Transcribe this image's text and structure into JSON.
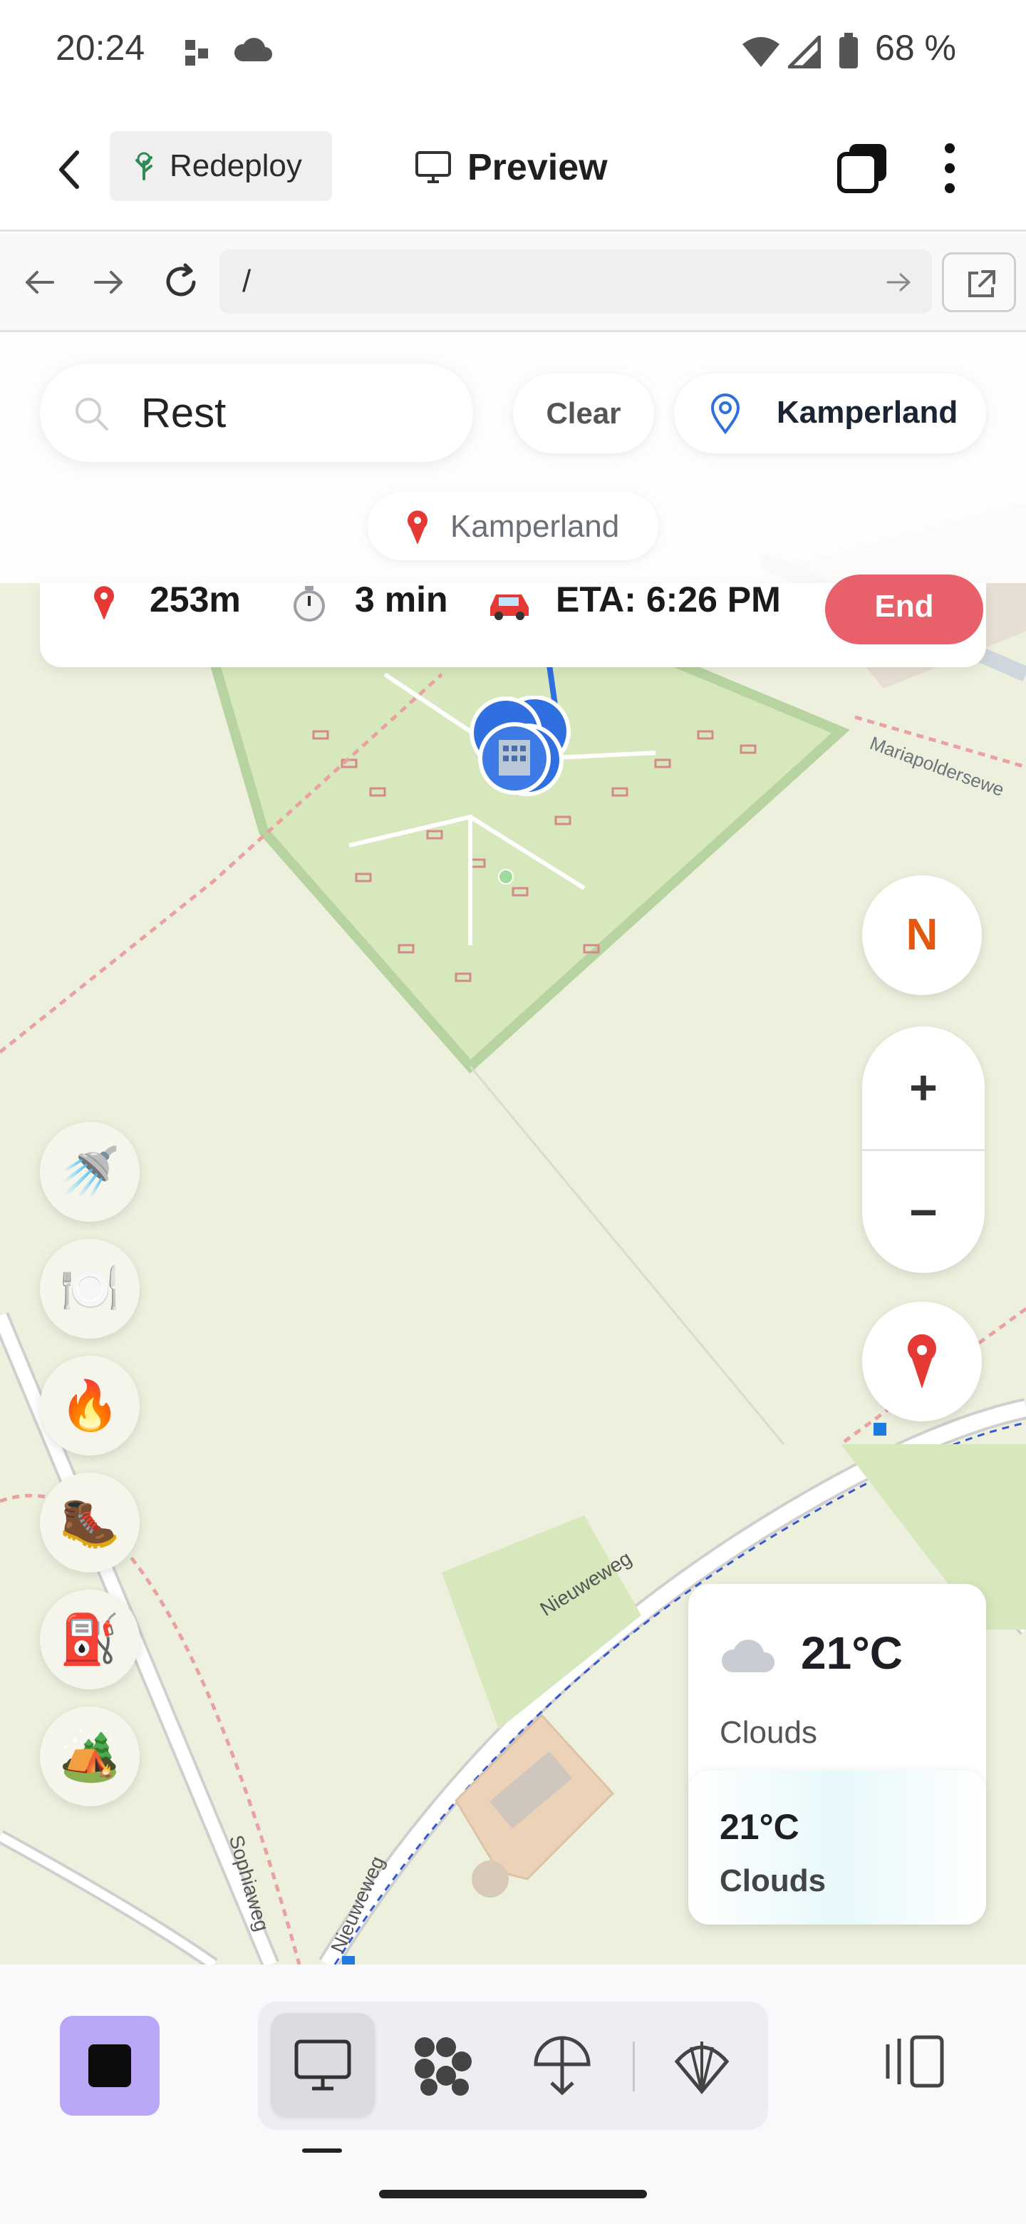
{
  "status_bar": {
    "time": "20:24",
    "battery": "68 %"
  },
  "app_bar": {
    "redeploy_label": "Redeploy",
    "preview_label": "Preview"
  },
  "browser": {
    "url": "/"
  },
  "search": {
    "query": "Rest",
    "clear_label": "Clear",
    "location_label": "Kamperland",
    "location_chip": "Kamperland"
  },
  "route": {
    "distance": "253m",
    "duration": "3 min",
    "eta": "ETA: 6:26 PM",
    "end_label": "End"
  },
  "categories": [
    {
      "name": "shower",
      "emoji": "🚿"
    },
    {
      "name": "restaurant",
      "emoji": "🍽️"
    },
    {
      "name": "campfire",
      "emoji": "🔥"
    },
    {
      "name": "hiking",
      "emoji": "🥾"
    },
    {
      "name": "fuel",
      "emoji": "⛽"
    },
    {
      "name": "camping",
      "emoji": "🏕️"
    }
  ],
  "map_controls": {
    "north_label": "N",
    "zoom_in": "+",
    "zoom_out": "−"
  },
  "map_labels": {
    "road1": "Mariapoldersewe",
    "road2": "Nieuweweg",
    "road3": "Sophiaweg",
    "road4": "Nieuweweg"
  },
  "weather": {
    "temp": "21°C",
    "condition": "Clouds",
    "temp_secondary": "21°C",
    "condition_secondary": "Clouds"
  },
  "colors": {
    "accent": "#b9a6f6",
    "end_button": "#e8606a",
    "north": "#e4570f",
    "route_line": "#2f6fe0"
  }
}
